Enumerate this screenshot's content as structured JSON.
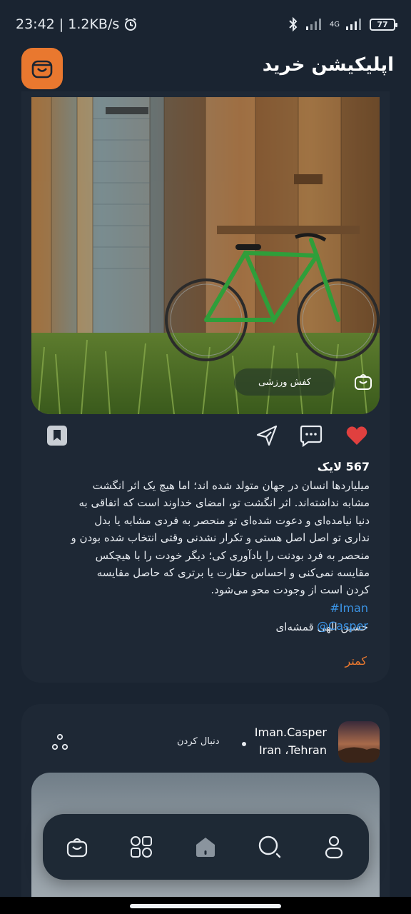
{
  "status_bar": {
    "time_speed": "23:42 | 1.2KB/s",
    "network": "4G",
    "battery": "77"
  },
  "header": {
    "title": "اپلیکیشن خرید",
    "logo_icon": "shopping-bag-icon",
    "accent": "#e9782f"
  },
  "post1": {
    "tag_label": "کفش ورزشی",
    "likes": "567 لایک",
    "caption_lines": [
      "میلیاردها انسان در جهان متولد شده اند؛ اما هیچ یک اثر انگشت",
      "مشابه نداشته‌اند. اثر انگشت تو، امضای خداوند است که اتفاقی به",
      "دنیا نیامده‌ای و دعوت شده‌ای تو منحصر به فردی مشابه یا بدل",
      "نداری تو اصل اصل هستی و تکرار نشدنی وقتی انتخاب شده بودن و",
      "منحصر به فرد بودنت را یادآوری کی؛ دیگر خودت را با هیچکس",
      "مقایسه نمی‌کنی و احساس حقارت یا برتری که حاصل مقایسه",
      "کردن است از وجودت محو می‌شود."
    ],
    "author": "حسین الهی قمشه‌ای",
    "hashtag": "#Iman",
    "mention": "@Casper",
    "less_label": "کمتر"
  },
  "post2": {
    "username": "Iman.Casper",
    "location": "Iran ،Tehran",
    "follow_label": "دنبال کردن"
  },
  "colors": {
    "background": "#1a2431",
    "card": "#1e2835",
    "link": "#3b93e4",
    "like": "#e0403f"
  }
}
